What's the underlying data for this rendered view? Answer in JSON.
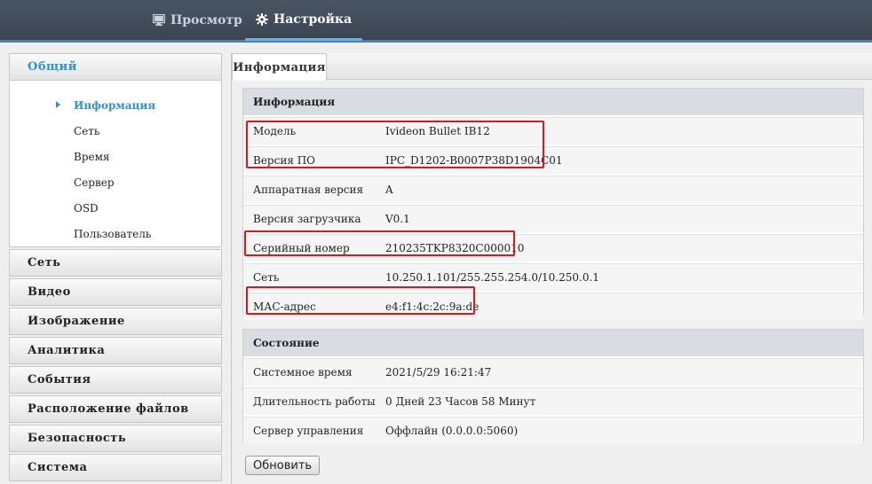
{
  "topnav": {
    "tabs": [
      {
        "label": "Просмотр",
        "icon": "monitor-icon"
      },
      {
        "label": "Настройка",
        "icon": "gear-icon"
      }
    ]
  },
  "sidebar": {
    "sections": [
      {
        "label": "Общий"
      },
      {
        "label": "Сеть"
      },
      {
        "label": "Видео"
      },
      {
        "label": "Изображение"
      },
      {
        "label": "Аналитика"
      },
      {
        "label": "События"
      },
      {
        "label": "Расположение файлов"
      },
      {
        "label": "Безопасность"
      },
      {
        "label": "Система"
      }
    ],
    "sub_items": [
      {
        "label": "Информация"
      },
      {
        "label": "Сеть"
      },
      {
        "label": "Время"
      },
      {
        "label": "Сервер"
      },
      {
        "label": "OSD"
      },
      {
        "label": "Пользователь"
      }
    ]
  },
  "main": {
    "tab_label": "Информация",
    "info": {
      "title": "Информация",
      "rows": [
        {
          "label": "Модель",
          "value": "Ivideon Bullet IB12"
        },
        {
          "label": "Версия ПО",
          "value": "IPC_D1202-B0007P38D1904C01"
        },
        {
          "label": "Аппаратная версия",
          "value": "A"
        },
        {
          "label": "Версия загрузчика",
          "value": "V0.1"
        },
        {
          "label": "Серийный номер",
          "value": "210235TKP8320C000010"
        },
        {
          "label": "Сеть",
          "value": "10.250.1.101/255.255.254.0/10.250.0.1"
        },
        {
          "label": "МАС-адрес",
          "value": "e4:f1:4c:2c:9a:de"
        }
      ]
    },
    "status": {
      "title": "Состояние",
      "rows": [
        {
          "label": "Системное время",
          "value": "2021/5/29 16:21:47"
        },
        {
          "label": "Длительность работы",
          "value": "0 Дней 23 Часов 58 Минут"
        },
        {
          "label": "Сервер управления",
          "value": "Оффлайн (0.0.0.0:5060)"
        }
      ]
    },
    "refresh_label": "Обновить"
  }
}
